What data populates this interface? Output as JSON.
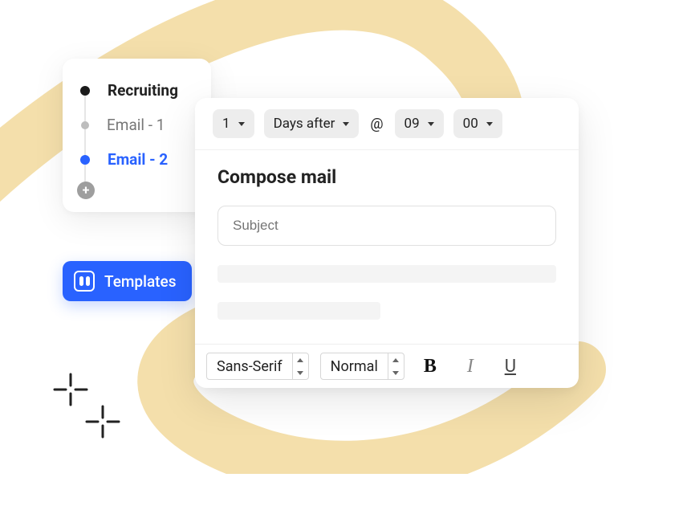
{
  "sidebar": {
    "title": "Recruiting",
    "items": [
      {
        "label": "Email - 1",
        "active": false
      },
      {
        "label": "Email - 2",
        "active": true
      }
    ]
  },
  "templates_button": {
    "label": "Templates"
  },
  "schedule": {
    "count": "1",
    "unit": "Days after",
    "at_symbol": "@",
    "hour": "09",
    "minute": "00"
  },
  "compose": {
    "heading": "Compose mail",
    "subject_placeholder": "Subject"
  },
  "toolbar": {
    "font": "Sans-Serif",
    "size": "Normal",
    "bold_label": "B",
    "italic_label": "I",
    "underline_label": "U"
  }
}
